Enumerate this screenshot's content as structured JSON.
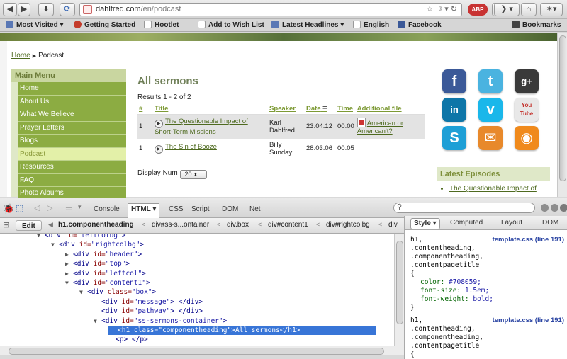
{
  "browser": {
    "url_host": "dahlfred.com",
    "url_path": "/en/podcast",
    "abp_label": "ABP"
  },
  "bookmarks": [
    {
      "label": "Most Visited",
      "icon": "folder-icon",
      "color": "#5a78b5"
    },
    {
      "label": "Getting Started",
      "icon": "ladybug-icon",
      "color": "#c43b2a"
    },
    {
      "label": "Hootlet",
      "icon": "page-icon",
      "color": "#ffffff"
    },
    {
      "label": "Add to Wish List",
      "icon": "page-icon",
      "color": "#ffffff"
    },
    {
      "label": "Latest Headlines",
      "icon": "rss-icon",
      "color": "#5a78b5"
    },
    {
      "label": "English",
      "icon": "page-icon",
      "color": "#ffffff"
    },
    {
      "label": "Facebook",
      "icon": "facebook-icon",
      "color": "#3b5998"
    },
    {
      "label": "Bookmarks",
      "icon": "star-icon",
      "color": "#444444"
    }
  ],
  "breadcrumb": {
    "home": "Home",
    "current": "Podcast"
  },
  "menu": {
    "title": "Main Menu",
    "items": [
      "Home",
      "About Us",
      "What We Believe",
      "Prayer Letters",
      "Blogs",
      "Podcast",
      "Resources",
      "FAQ",
      "Photo Albums"
    ],
    "active_index": 5
  },
  "content": {
    "title": "All sermons",
    "results": "Results 1 - 2 of 2",
    "columns": [
      "#",
      "Title",
      "Speaker",
      "Date",
      "Time",
      "Additional file"
    ],
    "rows": [
      {
        "num": "1",
        "title": "The Questionable Impact of Short-Term Missions",
        "speaker": "Karl Dahlfred",
        "date": "23.04.12",
        "time": "00:00",
        "file": "American or American't?"
      },
      {
        "num": "1",
        "title": "The Sin of Booze",
        "speaker": "Billy Sunday",
        "date": "28.03.06",
        "time": "00:05",
        "file": ""
      }
    ],
    "display_label": "Display Num",
    "display_value": "20"
  },
  "social": [
    {
      "name": "facebook",
      "glyph": "f",
      "color": "#3b5998"
    },
    {
      "name": "twitter",
      "glyph": "t",
      "color": "#4ab3e0"
    },
    {
      "name": "google-plus",
      "glyph": "g+",
      "color": "#3a3a3a"
    },
    {
      "name": "linkedin",
      "glyph": "in",
      "color": "#0e76a8"
    },
    {
      "name": "vimeo",
      "glyph": "v",
      "color": "#1ab7ea"
    },
    {
      "name": "youtube",
      "glyph": "You Tube",
      "color": "#e8e8e8"
    },
    {
      "name": "skype",
      "glyph": "S",
      "color": "#1e9fd6"
    },
    {
      "name": "email",
      "glyph": "✉",
      "color": "#e8892b"
    },
    {
      "name": "rss",
      "glyph": "◉",
      "color": "#f08a1c"
    }
  ],
  "latest": {
    "title": "Latest Episodes",
    "items": [
      "The Questionable Impact of"
    ]
  },
  "firebug": {
    "tabs": [
      "Console",
      "HTML",
      "CSS",
      "Script",
      "DOM",
      "Net"
    ],
    "active_tab": "HTML",
    "edit_label": "Edit",
    "crumbs": [
      "h1.componentheading",
      "div#ss-s...ontainer",
      "div.box",
      "div#content1",
      "div#rightcolbg",
      "div"
    ],
    "side_tabs": [
      "Style",
      "Computed",
      "Layout",
      "DOM"
    ],
    "tree": [
      {
        "indent": 0,
        "tw": "▼",
        "tag": "div",
        "attr": "id",
        "val": "leftcolbg",
        "tail": ">"
      },
      {
        "indent": 1,
        "tw": "▼",
        "tag": "div",
        "attr": "id",
        "val": "rightcolbg",
        "tail": ">"
      },
      {
        "indent": 2,
        "tw": "▶",
        "tag": "div",
        "attr": "id",
        "val": "header",
        "tail": ">"
      },
      {
        "indent": 2,
        "tw": "▶",
        "tag": "div",
        "attr": "id",
        "val": "top",
        "tail": ">"
      },
      {
        "indent": 2,
        "tw": "▶",
        "tag": "div",
        "attr": "id",
        "val": "leftcol",
        "tail": ">"
      },
      {
        "indent": 2,
        "tw": "▼",
        "tag": "div",
        "attr": "id",
        "val": "content1",
        "tail": ">"
      },
      {
        "indent": 3,
        "tw": "▼",
        "tag": "div",
        "attr": "class",
        "val": "box",
        "tail": ">"
      },
      {
        "indent": 4,
        "tw": "",
        "tag": "div",
        "attr": "id",
        "val": "message",
        "tail": "> </div>"
      },
      {
        "indent": 4,
        "tw": "",
        "tag": "div",
        "attr": "id",
        "val": "pathway",
        "tail": ">  </div>"
      },
      {
        "indent": 4,
        "tw": "▼",
        "tag": "div",
        "attr": "id",
        "val": "ss-sermons-container",
        "tail": ">"
      },
      {
        "indent": 5,
        "tw": "",
        "tag": "h1",
        "attr": "class",
        "val": "componentheading",
        "tail": ">All sermons</h1>"
      },
      {
        "indent": 5,
        "tw": "",
        "tag": "p",
        "attr": "",
        "val": "",
        "tail": ">   </p>"
      }
    ],
    "style_rules": [
      {
        "source": "template.css (line 191)",
        "selectors": [
          "h1,",
          ".contentheading,",
          ".componentheading,",
          ".contentpagetitle"
        ],
        "props": [
          {
            "name": "color",
            "value": "#708059;"
          },
          {
            "name": "font-size",
            "value": "1.5em;"
          },
          {
            "name": "font-weight",
            "value": "bold;"
          }
        ]
      },
      {
        "source": "template.css (line 191)",
        "selectors": [
          "h1,",
          ".contentheading,",
          ".componentheading,",
          ".contentpagetitle"
        ],
        "props": []
      }
    ]
  }
}
